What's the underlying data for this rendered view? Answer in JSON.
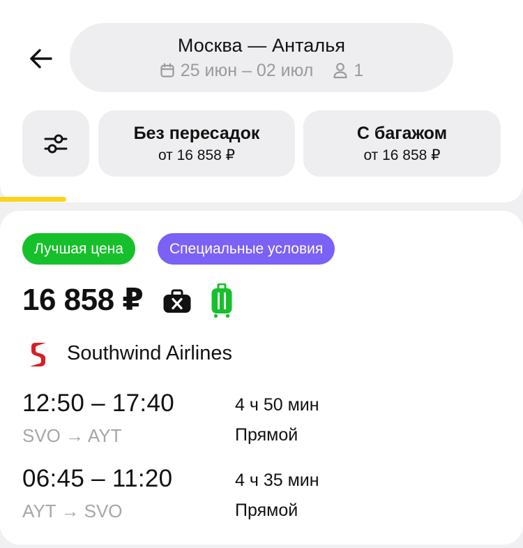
{
  "header": {
    "route_title": "Москва — Анталья",
    "dates": "25 июн – 02 июл",
    "passengers": "1",
    "back_icon": "arrow-left-icon",
    "calendar_icon": "calendar-icon",
    "passenger_icon": "person-icon"
  },
  "filters": {
    "settings_icon": "sliders-icon",
    "direct": {
      "title": "Без пересадок",
      "price": "от 16 858 ₽"
    },
    "baggage": {
      "title": "С багажом",
      "price": "от 16 858 ₽"
    }
  },
  "loading_progress_color": "#ffd21a",
  "offer": {
    "badges": [
      {
        "label": "Лучшая цена",
        "color": "#16c02a"
      },
      {
        "label": "Специальные условия",
        "color": "#7b61f5"
      }
    ],
    "price": "16 858 ₽",
    "no_hand_bag_icon": "bag-crossed-icon",
    "luggage_icon": "suitcase-icon",
    "airline": {
      "name": "Southwind Airlines",
      "logo_icon": "southwind-s-logo"
    },
    "legs": [
      {
        "time": "12:50 – 17:40",
        "route": "SVO → AYT",
        "duration": "4 ч 50 мин",
        "type": "Прямой"
      },
      {
        "time": "06:45 – 11:20",
        "route": "AYT → SVO",
        "duration": "4 ч 35 мин",
        "type": "Прямой"
      }
    ]
  }
}
